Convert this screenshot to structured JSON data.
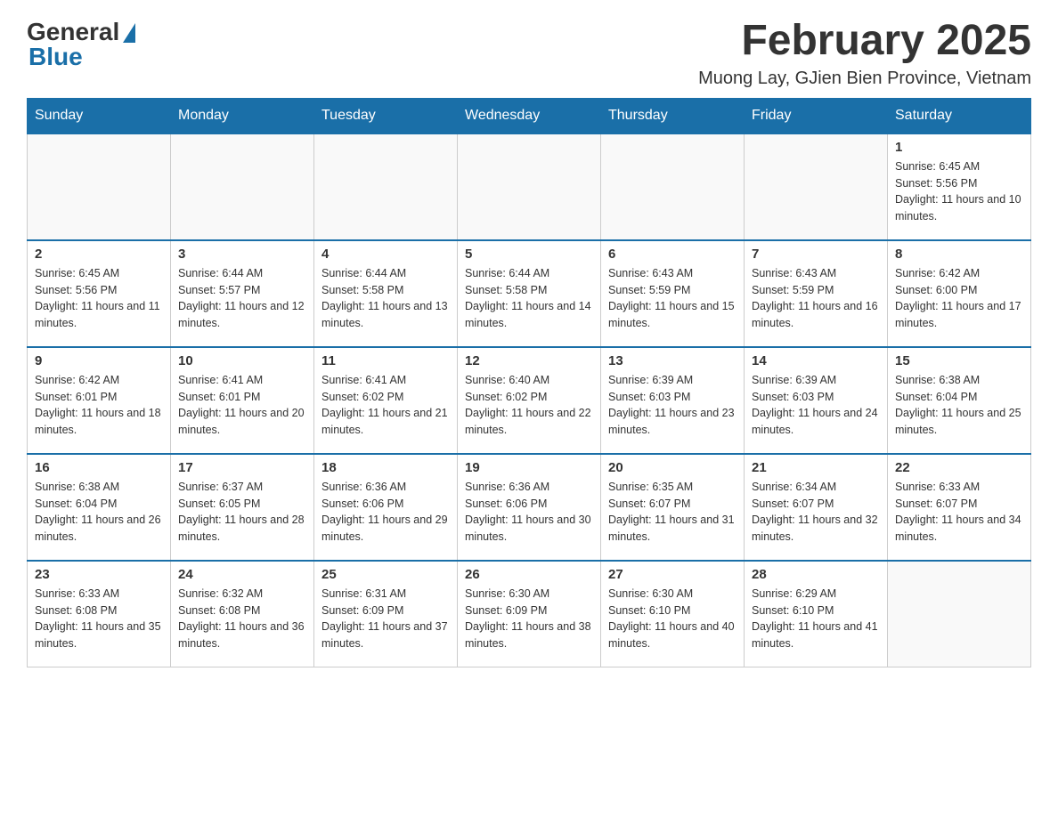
{
  "logo": {
    "general": "General",
    "blue": "Blue"
  },
  "header": {
    "month_year": "February 2025",
    "location": "Muong Lay, GJien Bien Province, Vietnam"
  },
  "weekdays": [
    "Sunday",
    "Monday",
    "Tuesday",
    "Wednesday",
    "Thursday",
    "Friday",
    "Saturday"
  ],
  "weeks": [
    [
      {
        "day": "",
        "info": ""
      },
      {
        "day": "",
        "info": ""
      },
      {
        "day": "",
        "info": ""
      },
      {
        "day": "",
        "info": ""
      },
      {
        "day": "",
        "info": ""
      },
      {
        "day": "",
        "info": ""
      },
      {
        "day": "1",
        "info": "Sunrise: 6:45 AM\nSunset: 5:56 PM\nDaylight: 11 hours and 10 minutes."
      }
    ],
    [
      {
        "day": "2",
        "info": "Sunrise: 6:45 AM\nSunset: 5:56 PM\nDaylight: 11 hours and 11 minutes."
      },
      {
        "day": "3",
        "info": "Sunrise: 6:44 AM\nSunset: 5:57 PM\nDaylight: 11 hours and 12 minutes."
      },
      {
        "day": "4",
        "info": "Sunrise: 6:44 AM\nSunset: 5:58 PM\nDaylight: 11 hours and 13 minutes."
      },
      {
        "day": "5",
        "info": "Sunrise: 6:44 AM\nSunset: 5:58 PM\nDaylight: 11 hours and 14 minutes."
      },
      {
        "day": "6",
        "info": "Sunrise: 6:43 AM\nSunset: 5:59 PM\nDaylight: 11 hours and 15 minutes."
      },
      {
        "day": "7",
        "info": "Sunrise: 6:43 AM\nSunset: 5:59 PM\nDaylight: 11 hours and 16 minutes."
      },
      {
        "day": "8",
        "info": "Sunrise: 6:42 AM\nSunset: 6:00 PM\nDaylight: 11 hours and 17 minutes."
      }
    ],
    [
      {
        "day": "9",
        "info": "Sunrise: 6:42 AM\nSunset: 6:01 PM\nDaylight: 11 hours and 18 minutes."
      },
      {
        "day": "10",
        "info": "Sunrise: 6:41 AM\nSunset: 6:01 PM\nDaylight: 11 hours and 20 minutes."
      },
      {
        "day": "11",
        "info": "Sunrise: 6:41 AM\nSunset: 6:02 PM\nDaylight: 11 hours and 21 minutes."
      },
      {
        "day": "12",
        "info": "Sunrise: 6:40 AM\nSunset: 6:02 PM\nDaylight: 11 hours and 22 minutes."
      },
      {
        "day": "13",
        "info": "Sunrise: 6:39 AM\nSunset: 6:03 PM\nDaylight: 11 hours and 23 minutes."
      },
      {
        "day": "14",
        "info": "Sunrise: 6:39 AM\nSunset: 6:03 PM\nDaylight: 11 hours and 24 minutes."
      },
      {
        "day": "15",
        "info": "Sunrise: 6:38 AM\nSunset: 6:04 PM\nDaylight: 11 hours and 25 minutes."
      }
    ],
    [
      {
        "day": "16",
        "info": "Sunrise: 6:38 AM\nSunset: 6:04 PM\nDaylight: 11 hours and 26 minutes."
      },
      {
        "day": "17",
        "info": "Sunrise: 6:37 AM\nSunset: 6:05 PM\nDaylight: 11 hours and 28 minutes."
      },
      {
        "day": "18",
        "info": "Sunrise: 6:36 AM\nSunset: 6:06 PM\nDaylight: 11 hours and 29 minutes."
      },
      {
        "day": "19",
        "info": "Sunrise: 6:36 AM\nSunset: 6:06 PM\nDaylight: 11 hours and 30 minutes."
      },
      {
        "day": "20",
        "info": "Sunrise: 6:35 AM\nSunset: 6:07 PM\nDaylight: 11 hours and 31 minutes."
      },
      {
        "day": "21",
        "info": "Sunrise: 6:34 AM\nSunset: 6:07 PM\nDaylight: 11 hours and 32 minutes."
      },
      {
        "day": "22",
        "info": "Sunrise: 6:33 AM\nSunset: 6:07 PM\nDaylight: 11 hours and 34 minutes."
      }
    ],
    [
      {
        "day": "23",
        "info": "Sunrise: 6:33 AM\nSunset: 6:08 PM\nDaylight: 11 hours and 35 minutes."
      },
      {
        "day": "24",
        "info": "Sunrise: 6:32 AM\nSunset: 6:08 PM\nDaylight: 11 hours and 36 minutes."
      },
      {
        "day": "25",
        "info": "Sunrise: 6:31 AM\nSunset: 6:09 PM\nDaylight: 11 hours and 37 minutes."
      },
      {
        "day": "26",
        "info": "Sunrise: 6:30 AM\nSunset: 6:09 PM\nDaylight: 11 hours and 38 minutes."
      },
      {
        "day": "27",
        "info": "Sunrise: 6:30 AM\nSunset: 6:10 PM\nDaylight: 11 hours and 40 minutes."
      },
      {
        "day": "28",
        "info": "Sunrise: 6:29 AM\nSunset: 6:10 PM\nDaylight: 11 hours and 41 minutes."
      },
      {
        "day": "",
        "info": ""
      }
    ]
  ]
}
